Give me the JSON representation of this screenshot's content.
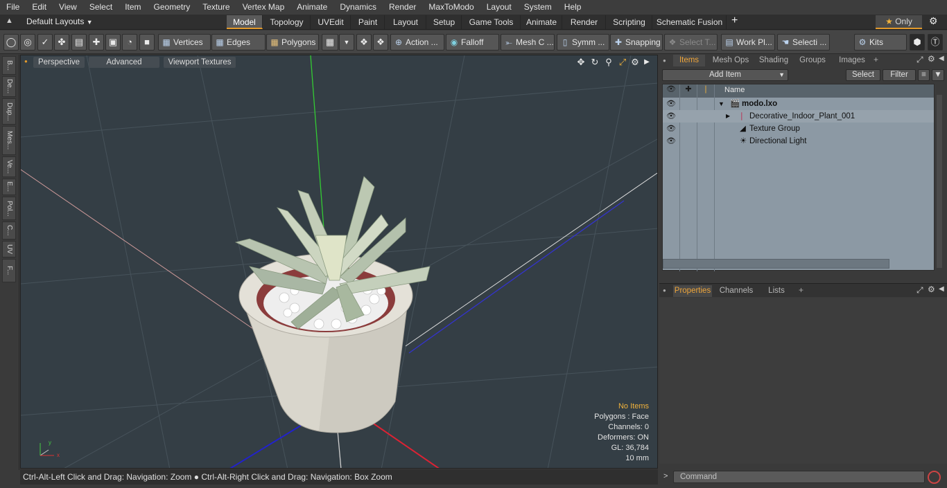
{
  "menu": [
    "File",
    "Edit",
    "View",
    "Select",
    "Item",
    "Geometry",
    "Texture",
    "Vertex Map",
    "Animate",
    "Dynamics",
    "Render",
    "MaxToModo",
    "Layout",
    "System",
    "Help"
  ],
  "layout_selector": "Default Layouts",
  "layout_tabs": [
    "Model",
    "Topology",
    "UVEdit",
    "Paint",
    "Layout",
    "Setup",
    "Game Tools",
    "Animate",
    "Render",
    "Scripting",
    "Schematic Fusion"
  ],
  "add_tab": "+",
  "only_label": "Only",
  "toolbar": {
    "vertices": "Vertices",
    "edges": "Edges",
    "polygons": "Polygons",
    "action": "Action ...",
    "falloff": "Falloff",
    "mesh": "Mesh C ...",
    "symmetry": "Symm ...",
    "snapping": "Snapping",
    "select_t": "Select T...",
    "workplane": "Work Pl...",
    "selection": "Selecti ...",
    "kits": "Kits"
  },
  "left_tabs": [
    "B...",
    "De...",
    "Dup...",
    "Mes...",
    "Ve...",
    "E...",
    "Pol...",
    "C...",
    "UV",
    "F..."
  ],
  "viewport": {
    "perspective": "Perspective",
    "advanced": "Advanced",
    "textures": "Viewport Textures",
    "info": {
      "no_items": "No Items",
      "polygons": "Polygons : Face",
      "channels": "Channels: 0",
      "deformers": "Deformers: ON",
      "gl": "GL: 36,784",
      "scale": "10 mm"
    }
  },
  "status": "Ctrl-Alt-Left Click and Drag: Navigation: Zoom ● Ctrl-Alt-Right Click and Drag: Navigation: Box Zoom",
  "items_panel": {
    "tabs": [
      "Items",
      "Mesh Ops",
      "Shading",
      "Groups",
      "Images"
    ],
    "add_item": "Add Item",
    "select": "Select",
    "filter": "Filter",
    "name_header": "Name",
    "rows": [
      "modo.lxo",
      "Decorative_Indoor_Plant_001",
      "Texture Group",
      "Directional Light"
    ]
  },
  "properties_panel": {
    "tabs": [
      "Properties",
      "Channels",
      "Lists"
    ]
  },
  "command_placeholder": "Command",
  "colors": {
    "accent": "#e39a2b",
    "viewport_bg": "#343e45",
    "items_bg": "#8c99a4"
  }
}
